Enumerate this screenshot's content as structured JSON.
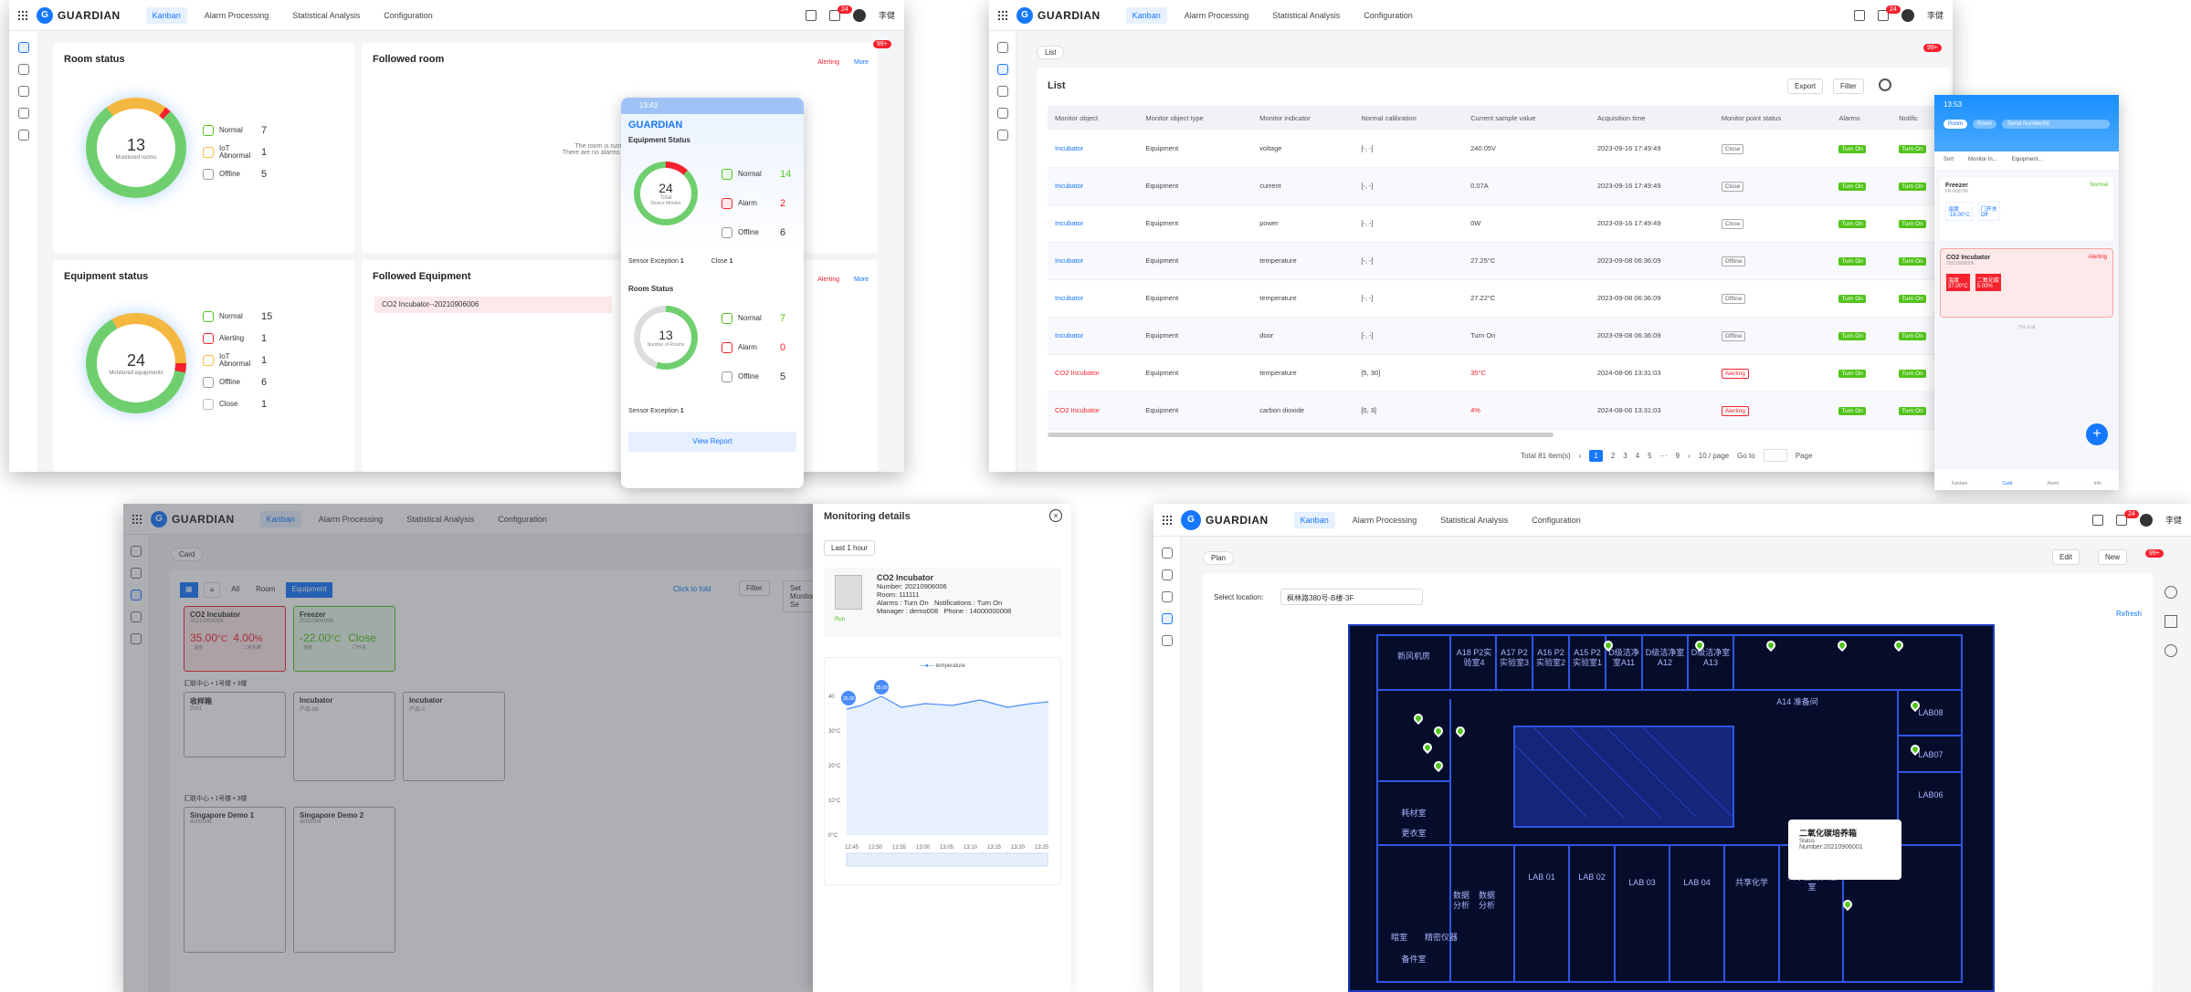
{
  "app": {
    "brand": "GUARDIAN",
    "tabs": [
      "Kanban",
      "Alarm Processing",
      "Statistical Analysis",
      "Configuration"
    ],
    "user": "李健",
    "badge": "24"
  },
  "kanban": {
    "room_status": {
      "title": "Room status",
      "total": "13",
      "total_label": "Monitored rooms",
      "legend": [
        {
          "label": "Normal",
          "value": "7"
        },
        {
          "label": "IoT Abnormal",
          "value": "1"
        },
        {
          "label": "Offline",
          "value": "5"
        }
      ]
    },
    "followed_room": {
      "title": "Followed room",
      "alerting": "Alerting",
      "more": "More",
      "empty1": "The room is runn",
      "empty2": "There are no alarms need"
    },
    "equipment_status": {
      "title": "Equipment status",
      "total": "24",
      "total_label": "Monitored equipments",
      "legend": [
        {
          "label": "Normal",
          "value": "15"
        },
        {
          "label": "Alerting",
          "value": "1"
        },
        {
          "label": "IoT Abnormal",
          "value": "1"
        },
        {
          "label": "Offline",
          "value": "6"
        },
        {
          "label": "Close",
          "value": "1"
        }
      ]
    },
    "followed_equipment": {
      "title": "Followed Equipment",
      "alerting": "Alerting",
      "more": "More",
      "item": "CO2 Incubator--20210906006"
    },
    "badge99": "99+"
  },
  "phone1": {
    "time": "13:43",
    "brand": "GUARDIAN",
    "equip_title": "Equipment Status",
    "equip_total": "24",
    "equip_total_label": "Total",
    "equip_total_sub": "Device Monitor",
    "equip_legend": [
      {
        "label": "Normal",
        "value": "14"
      },
      {
        "label": "Alarm",
        "value": "2"
      },
      {
        "label": "Offline",
        "value": "6"
      }
    ],
    "sensor": "Sensor Exception",
    "sensor_v": "1",
    "close": "Close",
    "close_v": "1",
    "room_title": "Room Status",
    "room_total": "13",
    "room_total_label": "Number of Rooms",
    "room_legend": [
      {
        "label": "Normal",
        "value": "7"
      },
      {
        "label": "Alarm",
        "value": "0"
      },
      {
        "label": "Offline",
        "value": "5"
      }
    ],
    "room_sensor": "Sensor Exception",
    "room_sensor_v": "1",
    "view_report": "View Report"
  },
  "list": {
    "crumb": "List",
    "title": "List",
    "export": "Export",
    "filter": "Filter",
    "badge": "99+",
    "columns": [
      "Monitor object",
      "Monitor object type",
      "Monitor indicator",
      "Normal calibration",
      "Current sample value",
      "Acquisition time",
      "Monitor point status",
      "Alarms",
      "Notific"
    ],
    "rows": [
      [
        "Incubator",
        "Equipment",
        "voltage",
        "[-, -]",
        "240.05V",
        "2023-09-16 17:49:49",
        "Close",
        "Turn On"
      ],
      [
        "Incubator",
        "Equipment",
        "current",
        "[-, -]",
        "0.07A",
        "2023-09-16 17:49:49",
        "Close",
        "Turn On"
      ],
      [
        "Incubator",
        "Equipment",
        "power",
        "[-, -]",
        "0W",
        "2023-09-16 17:49:49",
        "Close",
        "Turn On"
      ],
      [
        "Incubator",
        "Equipment",
        "temperature",
        "[-, -]",
        "27.25°C",
        "2023-09-08 06:36:09",
        "Offline",
        "Turn On"
      ],
      [
        "Incubator",
        "Equipment",
        "temperature",
        "[-, -]",
        "27.22°C",
        "2023-09-08 06:36:09",
        "Offline",
        "Turn On"
      ],
      [
        "Incubator",
        "Equipment",
        "door",
        "[-, -]",
        "Turn On",
        "2023-09-08 06:36:09",
        "Offline",
        "Turn On"
      ],
      [
        "CO2 Incubator",
        "Equipment",
        "temperature",
        "[5, 30]",
        "35°C",
        "2024-08-06 13:31:03",
        "Alerting",
        "Turn On"
      ],
      [
        "CO2 Incubator",
        "Equipment",
        "carbon dioxide",
        "[0, 3]",
        "4%",
        "2024-08-06 13:31:03",
        "Alerting",
        "Turn On"
      ]
    ],
    "total": "Total 81 item(s)",
    "pages": [
      "1",
      "2",
      "3",
      "4",
      "5",
      "···",
      "9"
    ],
    "per_page": "10 / page",
    "goto": "Go to",
    "page": "Page"
  },
  "phone2": {
    "time": "13:53",
    "tab1": "Room",
    "tab2": "Room",
    "search": "Serial Number/Nt",
    "filters": [
      "Sort",
      "Monitor In...",
      "Equipment..."
    ],
    "item1": {
      "name": "Freezer",
      "sub": "FR-008706",
      "status": "Normal",
      "v1": "-18.00°C",
      "l1": "温度",
      "v2": "Off",
      "l2": "门开关"
    },
    "item2": {
      "name": "CO2 Incubator",
      "sub": "20210906006",
      "status": "Alerting",
      "v1": "37.00°C",
      "l1": "温度",
      "v2": "5.00%",
      "l2": "二氧化碳"
    },
    "end": "The End",
    "nav": [
      "Kanban",
      "Card",
      "Alarm",
      "Info"
    ]
  },
  "cardview": {
    "crumb": "Card",
    "filters": [
      "All",
      "Room",
      "Equipment"
    ],
    "fold": "Click to fold",
    "filter": "Filter",
    "set": "Set Monitoring Se",
    "top": [
      {
        "name": "CO2 Incubator",
        "sub": "20210906006",
        "v1": "35.00",
        "u1": "°C",
        "l1": "温度",
        "v2": "4.00",
        "u2": "%",
        "l2": "二氧化碳"
      },
      {
        "name": "Freezer",
        "sub": "20210906006",
        "v1": "-22.00",
        "u1": "°C",
        "l1": "温度",
        "v2": "Close",
        "u2": "",
        "l2": "门开关"
      }
    ],
    "group1": "汇联中心 • 1号楼 • 3楼",
    "g1": [
      {
        "name": "收样箱",
        "sub": "2001"
      },
      {
        "name": "Incubator",
        "sub": "产品-86"
      },
      {
        "name": "Incubator",
        "sub": "产品-5"
      }
    ],
    "group2": "汇联中心 • 1号楼 • 3楼",
    "g2": [
      {
        "name": "Singapore Demo 1",
        "sub": "4000006"
      },
      {
        "name": "Singapore Demo 2",
        "sub": "4000004"
      }
    ]
  },
  "details": {
    "title": "Monitoring details",
    "range": "Last 1 hour",
    "name": "CO2 Incubator",
    "number": "Number: 20210906006",
    "room": "Room:   111111",
    "alarms": "Alarms : Turn On",
    "notif": "Notifications : Turn On",
    "manager": "Manager : demo008",
    "phone": "Phone : 14000000008",
    "run": "Run",
    "legend": "temperature",
    "yticks": [
      "40",
      "30°C",
      "20°C",
      "10°C",
      "0°C"
    ],
    "xticks": [
      "12:45",
      "12:50",
      "12:55",
      "13:00",
      "13:05",
      "13:10",
      "13:15",
      "13:20",
      "13:25"
    ],
    "p1": "35.00",
    "p2": "35.00"
  },
  "plan": {
    "crumb": "Plan",
    "edit": "Edit",
    "new": "New",
    "badge": "99+",
    "loc_label": "Select location:",
    "loc": "枫林路380号-B楼-3F",
    "refresh": "Refresh",
    "rooms": [
      "新风机房",
      "A18 P2实验室4",
      "A17 P2实验室3",
      "A16 P2实验室2",
      "A15 P2实验室1",
      "D级洁净室A11",
      "D级洁净室A12",
      "D级洁净室A13",
      "A14 准备间",
      "LAB08",
      "LAB07",
      "LAB06",
      "LAB 01",
      "LAB 02",
      "LAB 03",
      "LAB 04",
      "共享化学",
      "共享生物实验室",
      "暗室",
      "精密仪器",
      "数据分析",
      "数据分析",
      "耗材室",
      "更衣室",
      "备件室"
    ],
    "tooltip": {
      "title": "二氧化碳培养箱",
      "status": "Status",
      "number": "Number:20210906001"
    }
  }
}
